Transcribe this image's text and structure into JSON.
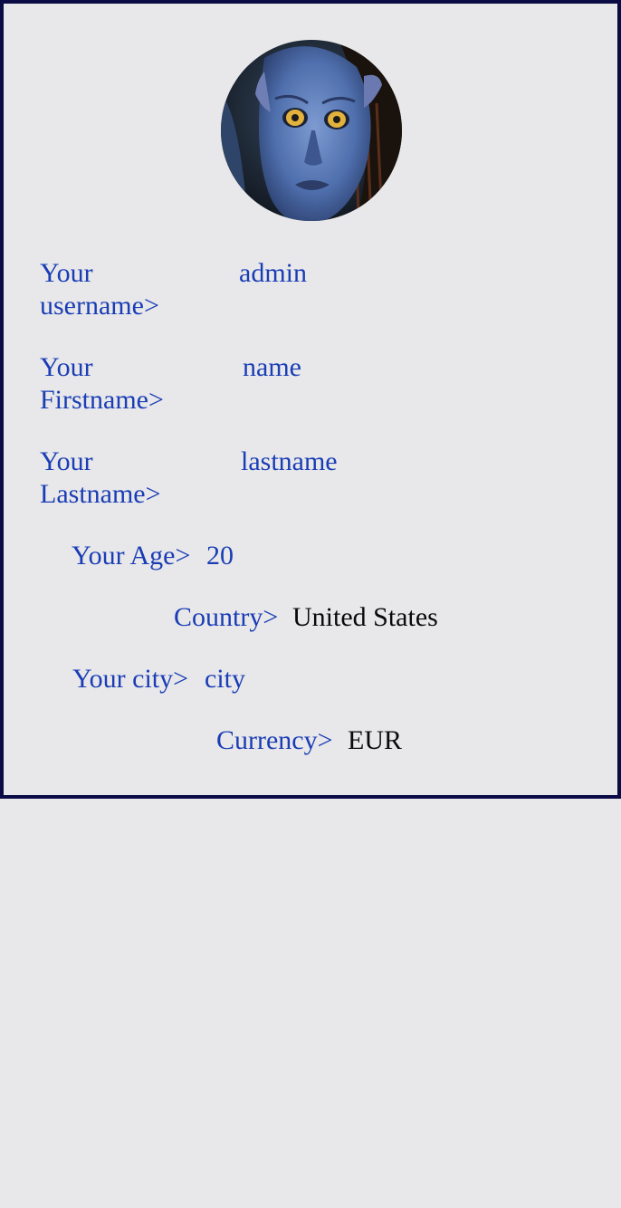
{
  "profile": {
    "username": {
      "label": "Your username>",
      "value": "admin"
    },
    "firstname": {
      "label": "Your Firstname>",
      "value": "name"
    },
    "lastname": {
      "label": "Your Lastname>",
      "value": "lastname"
    },
    "age": {
      "label": "Your Age>",
      "value": "20"
    },
    "country": {
      "label": "Country>",
      "value": "United States"
    },
    "city": {
      "label": "Your city>",
      "value": "city"
    },
    "currency": {
      "label": "Currency>",
      "value": "EUR"
    }
  },
  "colors": {
    "border": "#0b0b45",
    "background": "#e8e8ea",
    "label": "#1a3db5",
    "value_dark": "#0a0a0a"
  },
  "icons": {
    "avatar": "avatar-photo"
  }
}
